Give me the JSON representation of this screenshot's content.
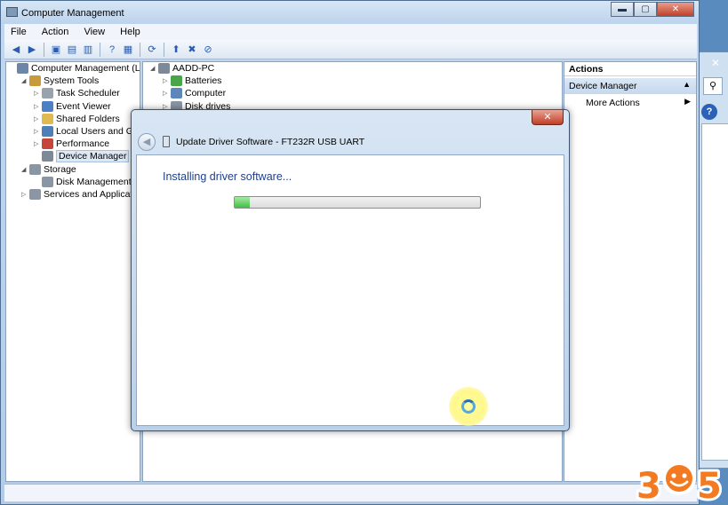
{
  "window": {
    "title": "Computer Management",
    "minimize": "▬",
    "maximize": "▢",
    "close": "✕"
  },
  "menu": [
    "File",
    "Action",
    "View",
    "Help"
  ],
  "tree": [
    {
      "label": "Computer Management (Local",
      "indent": 0,
      "arrow": "",
      "icon": "computer-management-icon",
      "color": "#6b86a8"
    },
    {
      "label": "System Tools",
      "indent": 1,
      "arrow": "◢",
      "icon": "tools-icon",
      "color": "#c79b3a"
    },
    {
      "label": "Task Scheduler",
      "indent": 2,
      "arrow": "▷",
      "icon": "clock-icon",
      "color": "#9aa3ad"
    },
    {
      "label": "Event Viewer",
      "indent": 2,
      "arrow": "▷",
      "icon": "event-viewer-icon",
      "color": "#4c7fc4"
    },
    {
      "label": "Shared Folders",
      "indent": 2,
      "arrow": "▷",
      "icon": "shared-folder-icon",
      "color": "#e0b94f"
    },
    {
      "label": "Local Users and Group",
      "indent": 2,
      "arrow": "▷",
      "icon": "users-icon",
      "color": "#4f7fb7"
    },
    {
      "label": "Performance",
      "indent": 2,
      "arrow": "▷",
      "icon": "performance-icon",
      "color": "#c5453a"
    },
    {
      "label": "Device Manager",
      "indent": 2,
      "arrow": "",
      "icon": "device-manager-icon",
      "color": "#7d8996",
      "selected": true
    },
    {
      "label": "Storage",
      "indent": 1,
      "arrow": "◢",
      "icon": "storage-icon",
      "color": "#8a96a3"
    },
    {
      "label": "Disk Management",
      "indent": 2,
      "arrow": "",
      "icon": "disk-icon",
      "color": "#8a96a3"
    },
    {
      "label": "Services and Applications",
      "indent": 1,
      "arrow": "▷",
      "icon": "services-icon",
      "color": "#8a96a3"
    }
  ],
  "devices": [
    {
      "label": "AADD-PC",
      "indent": 0,
      "arrow": "◢",
      "icon": "pc-icon",
      "color": "#7d8996"
    },
    {
      "label": "Batteries",
      "indent": 1,
      "arrow": "▷",
      "icon": "battery-icon",
      "color": "#4aa54a"
    },
    {
      "label": "Computer",
      "indent": 1,
      "arrow": "▷",
      "icon": "computer-icon",
      "color": "#5d87b9"
    },
    {
      "label": "Disk drives",
      "indent": 1,
      "arrow": "▷",
      "icon": "disk-drive-icon",
      "color": "#8a96a3"
    }
  ],
  "actions": {
    "header": "Actions",
    "section": "Device Manager",
    "section_caret": "▲",
    "item": "More Actions",
    "item_caret": "▶"
  },
  "dialog": {
    "title": "Update Driver Software - FT232R USB UART",
    "close": "✕",
    "back": "◀",
    "heading": "Installing driver software...",
    "progress": 0.06
  },
  "logo": {
    "text": "305",
    "color": "#f37a21"
  },
  "bg_window": {
    "close": "✕",
    "search": "⚲",
    "help": "?"
  }
}
